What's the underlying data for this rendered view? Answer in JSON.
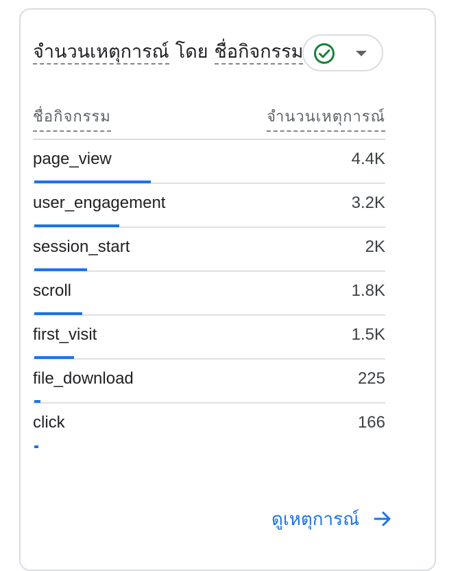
{
  "card": {
    "title_part1": "จำนวนเหตุการณ์",
    "title_part2": "โดย",
    "title_part3": "ชื่อกิจกรรม",
    "status_icon": "check-circle-icon",
    "status_color": "#188038"
  },
  "table": {
    "col_name_header": "ชื่อกิจกรรม",
    "col_count_header": "จำนวนเหตุการณ์",
    "rows": [
      {
        "name": "page_view",
        "count": "4.4K",
        "value": 4400
      },
      {
        "name": "user_engagement",
        "count": "3.2K",
        "value": 3200
      },
      {
        "name": "session_start",
        "count": "2K",
        "value": 2000
      },
      {
        "name": "scroll",
        "count": "1.8K",
        "value": 1800
      },
      {
        "name": "first_visit",
        "count": "1.5K",
        "value": 1500
      },
      {
        "name": "file_download",
        "count": "225",
        "value": 225
      },
      {
        "name": "click",
        "count": "166",
        "value": 166
      }
    ],
    "bar_color": "#1a73e8"
  },
  "footer": {
    "view_label": "ดูเหตุการณ์",
    "arrow_icon": "arrow-right-icon"
  }
}
